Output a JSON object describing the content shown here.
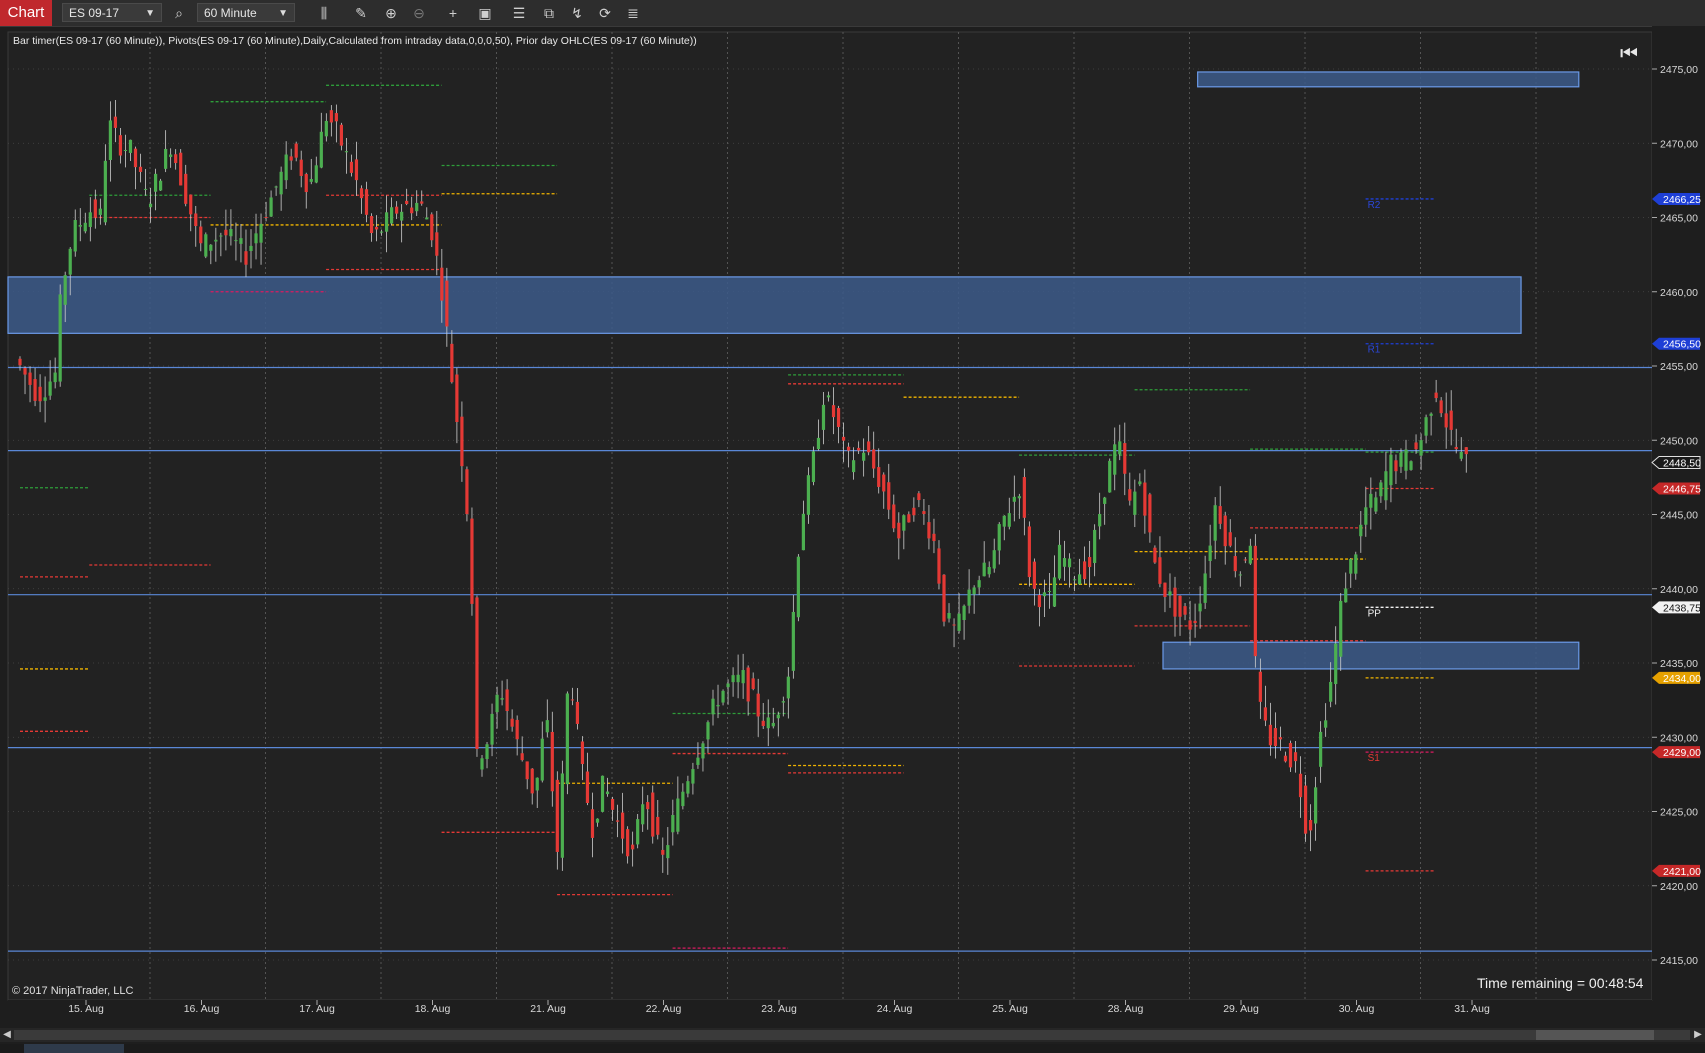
{
  "toolbar": {
    "chart_tab": "Chart",
    "instrument": "ES 09-17",
    "interval": "60 Minute",
    "icons": [
      "search-icon",
      "bar-type-icon",
      "draw-pencil-icon",
      "zoom-in-icon",
      "zoom-out-icon",
      "crosshair-icon",
      "data-box-icon",
      "properties-icon",
      "strategy-icon",
      "indicators-icon",
      "reload-icon",
      "menu-list-icon"
    ]
  },
  "chart": {
    "indicator_label": "Bar timer(ES 09-17 (60 Minute)), Pivots(ES 09-17 (60 Minute),Daily,Calculated from intraday data,0,0,0,50), Prior day OHLC(ES 09-17 (60 Minute))",
    "copyright": "© 2017 NinjaTrader, LLC",
    "time_remaining": "Time remaining = 00:48:54",
    "colors": {
      "up": "#4caf50",
      "down": "#e53935",
      "zone": "#3c5a8a",
      "hline": "#5a87d6",
      "grid": "#555555"
    }
  },
  "chart_data": {
    "type": "candlestick",
    "instrument": "ES 09-17",
    "interval": "60 Minute",
    "y_ticks": [
      "2475,00",
      "2470,00",
      "2465,00",
      "2460,00",
      "2455,00",
      "2450,00",
      "2445,00",
      "2440,00",
      "2435,00",
      "2430,00",
      "2425,00",
      "2420,00",
      "2415,00"
    ],
    "x_ticks": [
      "15. Aug",
      "16. Aug",
      "17. Aug",
      "18. Aug",
      "21. Aug",
      "22. Aug",
      "23. Aug",
      "24. Aug",
      "25. Aug",
      "28. Aug",
      "29. Aug",
      "30. Aug",
      "31. Aug"
    ],
    "price_markers": [
      {
        "label": "2466,25",
        "value": 2466.25,
        "color": "#1e3fd6"
      },
      {
        "label": "2456,50",
        "value": 2456.5,
        "color": "#1e3fd6"
      },
      {
        "label": "2448,50",
        "value": 2448.5,
        "color": "#1a1a1a"
      },
      {
        "label": "2446,75",
        "value": 2446.75,
        "color": "#c62828"
      },
      {
        "label": "2438,75",
        "value": 2438.75,
        "color": "#f2f2f2"
      },
      {
        "label": "2434,00",
        "value": 2434.0,
        "color": "#e6a100"
      },
      {
        "label": "2429,00",
        "value": 2429.0,
        "color": "#c62828"
      },
      {
        "label": "2421,00",
        "value": 2421.0,
        "color": "#c62828"
      }
    ],
    "pivot_labels": [
      {
        "label": "R2",
        "value": 2466.25,
        "color": "#2b47d8"
      },
      {
        "label": "R1",
        "value": 2456.5,
        "color": "#2b47d8"
      },
      {
        "label": "PP",
        "value": 2438.75,
        "color": "#f0f0f0"
      },
      {
        "label": "S1",
        "value": 2429.0,
        "color": "#e53935"
      }
    ],
    "horizontal_lines": [
      2454.9,
      2449.3,
      2439.6,
      2429.3,
      2415.6
    ],
    "zones": [
      {
        "from_day": 0,
        "to_day": 13.1,
        "low": 2457.2,
        "high": 2461.0
      },
      {
        "from_day": 10.3,
        "to_day": 13.6,
        "low": 2473.8,
        "high": 2474.8
      },
      {
        "from_day": 10.0,
        "to_day": 13.6,
        "low": 2434.6,
        "high": 2436.4
      }
    ],
    "daily_levels": [
      {
        "from_day": 0.0,
        "to_day": 0.6,
        "value": 2446.8,
        "color": "#2e9d3a"
      },
      {
        "from_day": 0.0,
        "to_day": 0.6,
        "value": 2440.8,
        "color": "#e53935"
      },
      {
        "from_day": 0.0,
        "to_day": 0.6,
        "value": 2434.6,
        "color": "#f0b400"
      },
      {
        "from_day": 0.0,
        "to_day": 0.6,
        "value": 2430.4,
        "color": "#e53935"
      },
      {
        "from_day": 0.6,
        "to_day": 1.65,
        "value": 2466.5,
        "color": "#2e9d3a"
      },
      {
        "from_day": 0.6,
        "to_day": 1.65,
        "value": 2465.0,
        "color": "#e53935"
      },
      {
        "from_day": 0.6,
        "to_day": 1.65,
        "value": 2441.6,
        "color": "#e53935"
      },
      {
        "from_day": 1.65,
        "to_day": 2.65,
        "value": 2472.8,
        "color": "#2e9d3a"
      },
      {
        "from_day": 1.65,
        "to_day": 2.65,
        "value": 2464.5,
        "color": "#f0b400"
      },
      {
        "from_day": 1.65,
        "to_day": 2.65,
        "value": 2460.0,
        "color": "#d81b60"
      },
      {
        "from_day": 2.65,
        "to_day": 3.65,
        "value": 2473.9,
        "color": "#2e9d3a"
      },
      {
        "from_day": 2.65,
        "to_day": 3.65,
        "value": 2466.5,
        "color": "#e53935"
      },
      {
        "from_day": 2.65,
        "to_day": 3.65,
        "value": 2464.5,
        "color": "#f0b400"
      },
      {
        "from_day": 2.65,
        "to_day": 3.65,
        "value": 2461.5,
        "color": "#e53935"
      },
      {
        "from_day": 3.65,
        "to_day": 4.65,
        "value": 2468.5,
        "color": "#2e9d3a"
      },
      {
        "from_day": 3.65,
        "to_day": 4.65,
        "value": 2466.6,
        "color": "#f0b400"
      },
      {
        "from_day": 3.65,
        "to_day": 4.65,
        "value": 2423.6,
        "color": "#e53935"
      },
      {
        "from_day": 4.65,
        "to_day": 5.65,
        "value": 2419.4,
        "color": "#e53935"
      },
      {
        "from_day": 4.65,
        "to_day": 5.65,
        "value": 2426.9,
        "color": "#f0b400"
      },
      {
        "from_day": 5.65,
        "to_day": 6.65,
        "value": 2431.6,
        "color": "#2e9d3a"
      },
      {
        "from_day": 5.65,
        "to_day": 6.65,
        "value": 2428.9,
        "color": "#e53935"
      },
      {
        "from_day": 5.65,
        "to_day": 6.65,
        "value": 2415.8,
        "color": "#d81b60"
      },
      {
        "from_day": 6.65,
        "to_day": 7.65,
        "value": 2454.4,
        "color": "#2e9d3a"
      },
      {
        "from_day": 6.65,
        "to_day": 7.65,
        "value": 2453.8,
        "color": "#e53935"
      },
      {
        "from_day": 6.65,
        "to_day": 7.65,
        "value": 2428.1,
        "color": "#f0b400"
      },
      {
        "from_day": 6.65,
        "to_day": 7.65,
        "value": 2427.6,
        "color": "#e53935"
      },
      {
        "from_day": 7.65,
        "to_day": 8.65,
        "value": 2452.9,
        "color": "#f0b400"
      },
      {
        "from_day": 8.65,
        "to_day": 9.65,
        "value": 2449.0,
        "color": "#2e9d3a"
      },
      {
        "from_day": 8.65,
        "to_day": 9.65,
        "value": 2440.3,
        "color": "#f0b400"
      },
      {
        "from_day": 8.65,
        "to_day": 9.65,
        "value": 2434.8,
        "color": "#e53935"
      },
      {
        "from_day": 9.65,
        "to_day": 10.65,
        "value": 2453.4,
        "color": "#2e9d3a"
      },
      {
        "from_day": 9.65,
        "to_day": 10.65,
        "value": 2442.5,
        "color": "#f0b400"
      },
      {
        "from_day": 9.65,
        "to_day": 10.65,
        "value": 2437.5,
        "color": "#e53935"
      },
      {
        "from_day": 10.65,
        "to_day": 11.65,
        "value": 2449.4,
        "color": "#2e9d3a"
      },
      {
        "from_day": 10.65,
        "to_day": 11.65,
        "value": 2444.1,
        "color": "#e53935"
      },
      {
        "from_day": 10.65,
        "to_day": 11.65,
        "value": 2442.0,
        "color": "#f0b400"
      },
      {
        "from_day": 10.65,
        "to_day": 11.65,
        "value": 2436.5,
        "color": "#e53935"
      },
      {
        "from_day": 11.65,
        "to_day": 12.25,
        "value": 2449.2,
        "color": "#2e9d3a"
      },
      {
        "from_day": 11.65,
        "to_day": 12.25,
        "value": 2446.75,
        "color": "#e53935"
      },
      {
        "from_day": 11.65,
        "to_day": 12.25,
        "value": 2434.0,
        "color": "#f0b400"
      },
      {
        "from_day": 11.65,
        "to_day": 12.25,
        "value": 2421.0,
        "color": "#e53935"
      },
      {
        "from_day": 11.65,
        "to_day": 12.25,
        "value": 2466.25,
        "color": "#1e3fd6"
      },
      {
        "from_day": 11.65,
        "to_day": 12.25,
        "value": 2456.5,
        "color": "#1e3fd6"
      },
      {
        "from_day": 11.65,
        "to_day": 12.25,
        "value": 2438.75,
        "color": "#f0f0f0"
      },
      {
        "from_day": 11.65,
        "to_day": 12.25,
        "value": 2429.0,
        "color": "#d81b60"
      }
    ],
    "price_path": [
      [
        0.0,
        2455.5
      ],
      [
        0.2,
        2453.0
      ],
      [
        0.35,
        2454.5
      ],
      [
        0.4,
        2460.0
      ],
      [
        0.5,
        2464.0
      ],
      [
        0.65,
        2465.5
      ],
      [
        0.75,
        2465.0
      ],
      [
        0.8,
        2471.5
      ],
      [
        0.9,
        2470.0
      ],
      [
        1.0,
        2469.5
      ],
      [
        1.15,
        2466.0
      ],
      [
        1.35,
        2470.0
      ],
      [
        1.5,
        2466.0
      ],
      [
        1.6,
        2463.0
      ],
      [
        1.8,
        2464.0
      ],
      [
        2.0,
        2462.5
      ],
      [
        2.2,
        2466.0
      ],
      [
        2.4,
        2469.5
      ],
      [
        2.55,
        2467.0
      ],
      [
        2.7,
        2472.0
      ],
      [
        2.8,
        2470.5
      ],
      [
        2.95,
        2467.5
      ],
      [
        3.1,
        2463.5
      ],
      [
        3.3,
        2465.5
      ],
      [
        3.5,
        2466.0
      ],
      [
        3.6,
        2464.5
      ],
      [
        3.7,
        2460.0
      ],
      [
        3.8,
        2453.0
      ],
      [
        3.9,
        2447.0
      ],
      [
        3.95,
        2441.0
      ],
      [
        4.0,
        2428.5
      ],
      [
        4.1,
        2430.0
      ],
      [
        4.2,
        2433.5
      ],
      [
        4.35,
        2429.5
      ],
      [
        4.5,
        2426.0
      ],
      [
        4.6,
        2431.5
      ],
      [
        4.7,
        2422.0
      ],
      [
        4.8,
        2435.0
      ],
      [
        4.9,
        2428.0
      ],
      [
        5.0,
        2424.0
      ],
      [
        5.1,
        2427.0
      ],
      [
        5.2,
        2424.5
      ],
      [
        5.35,
        2422.0
      ],
      [
        5.45,
        2426.5
      ],
      [
        5.6,
        2421.5
      ],
      [
        5.7,
        2424.5
      ],
      [
        5.85,
        2428.0
      ],
      [
        5.95,
        2430.0
      ],
      [
        6.1,
        2433.0
      ],
      [
        6.3,
        2434.0
      ],
      [
        6.45,
        2431.5
      ],
      [
        6.55,
        2430.5
      ],
      [
        6.7,
        2434.5
      ],
      [
        6.8,
        2444.5
      ],
      [
        6.9,
        2448.0
      ],
      [
        7.0,
        2453.0
      ],
      [
        7.1,
        2451.5
      ],
      [
        7.2,
        2448.5
      ],
      [
        7.35,
        2449.5
      ],
      [
        7.5,
        2447.0
      ],
      [
        7.65,
        2443.5
      ],
      [
        7.8,
        2446.0
      ],
      [
        7.95,
        2443.5
      ],
      [
        8.05,
        2438.0
      ],
      [
        8.15,
        2437.0
      ],
      [
        8.3,
        2440.5
      ],
      [
        8.45,
        2441.5
      ],
      [
        8.55,
        2444.5
      ],
      [
        8.7,
        2447.0
      ],
      [
        8.8,
        2440.0
      ],
      [
        8.95,
        2439.0
      ],
      [
        9.05,
        2442.5
      ],
      [
        9.15,
        2441.0
      ],
      [
        9.3,
        2441.5
      ],
      [
        9.45,
        2447.5
      ],
      [
        9.55,
        2450.0
      ],
      [
        9.65,
        2445.5
      ],
      [
        9.75,
        2447.5
      ],
      [
        9.85,
        2442.0
      ],
      [
        9.95,
        2440.0
      ],
      [
        10.1,
        2438.0
      ],
      [
        10.2,
        2437.5
      ],
      [
        10.3,
        2441.0
      ],
      [
        10.4,
        2446.0
      ],
      [
        10.5,
        2443.0
      ],
      [
        10.6,
        2441.0
      ],
      [
        10.7,
        2443.5
      ],
      [
        10.75,
        2432.5
      ],
      [
        10.85,
        2430.0
      ],
      [
        10.95,
        2429.5
      ],
      [
        11.1,
        2428.0
      ],
      [
        11.2,
        2423.0
      ],
      [
        11.3,
        2430.0
      ],
      [
        11.4,
        2434.0
      ],
      [
        11.5,
        2440.0
      ],
      [
        11.6,
        2442.5
      ],
      [
        11.7,
        2445.5
      ],
      [
        11.8,
        2446.0
      ],
      [
        11.9,
        2448.5
      ],
      [
        12.0,
        2448.5
      ],
      [
        12.15,
        2449.5
      ],
      [
        12.3,
        2453.5
      ],
      [
        12.4,
        2451.0
      ],
      [
        12.5,
        2449.0
      ],
      [
        12.55,
        2448.5
      ]
    ]
  }
}
